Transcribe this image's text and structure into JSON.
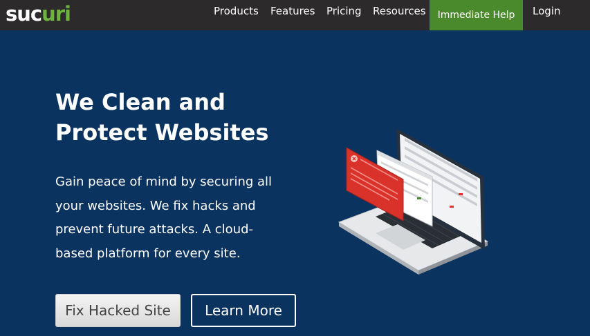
{
  "header": {
    "logo_main": "suc",
    "logo_accent": "uri",
    "nav": [
      "Products",
      "Features",
      "Pricing",
      "Resources"
    ],
    "help_label": "Immediate Help",
    "login_label": "Login"
  },
  "hero": {
    "headline_line1": "We Clean and",
    "headline_line2": "Protect Websites",
    "subtext": "Gain peace of mind by securing all your websites. We fix hacks and prevent future attacks. A cloud-based platform for every site.",
    "primary_button": "Fix Hacked Site",
    "secondary_button": "Learn More"
  },
  "colors": {
    "topbar": "#2c2a2a",
    "hero_bg": "#0b3360",
    "help_green": "#4a8a2c",
    "logo_accent": "#6fb33f",
    "alert_red": "#d9322a"
  },
  "icons": [
    "laptop-illustration",
    "warning-icon"
  ]
}
